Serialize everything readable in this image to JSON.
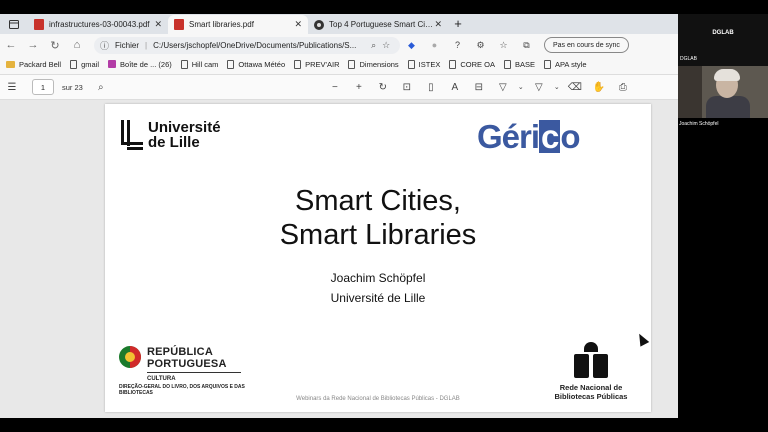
{
  "tabs": [
    {
      "label": "infrastructures-03-00043.pdf",
      "icon": "pdf-icon"
    },
    {
      "label": "Smart libraries.pdf",
      "icon": "pdf-icon",
      "active": true
    },
    {
      "label": "Top 4 Portuguese Smart Cities: E",
      "icon": "web-icon"
    }
  ],
  "address": {
    "prefix": "Fichier",
    "path": "C:/Users/jschopfel/OneDrive/Documents/Publications/S..."
  },
  "sync_label": "Pas en cours de sync",
  "bookmarks": [
    "Packard Bell",
    "gmail",
    "Boîte de ... (26)",
    "Hill cam",
    "Ottawa Météo",
    "PREV'AIR",
    "Dimensions",
    "ISTEX",
    "CORE OA",
    "BASE",
    "APA style"
  ],
  "pdf_toolbar": {
    "page": "1",
    "of": "sur 23"
  },
  "slide": {
    "univ_line1": "Université",
    "univ_line2": "de Lille",
    "gerico_pre": "Géri",
    "gerico_box": "c",
    "gerico_post": "o",
    "title_line1": "Smart Cities,",
    "title_line2": "Smart Libraries",
    "author": "Joachim Schöpfel",
    "affiliation": "Université de Lille",
    "rp_line1": "REPÚBLICA",
    "rp_line2": "PORTUGUESA",
    "rp_cultura": "CULTURA",
    "rp_dg": "DIREÇÃO-GERAL DO LIVRO, DOS ARQUIVOS E DAS BIBLIOTECAS",
    "footer": "Webinars da Rede Nacional de Bibliotecas Públicas - DGLAB",
    "rn_line1": "Rede Nacional de",
    "rn_line2": "Bibliotecas Públicas"
  },
  "video": {
    "name": "DGLAB",
    "tile_top": "DGLAB",
    "participant": "Joachim Schöpfel"
  }
}
